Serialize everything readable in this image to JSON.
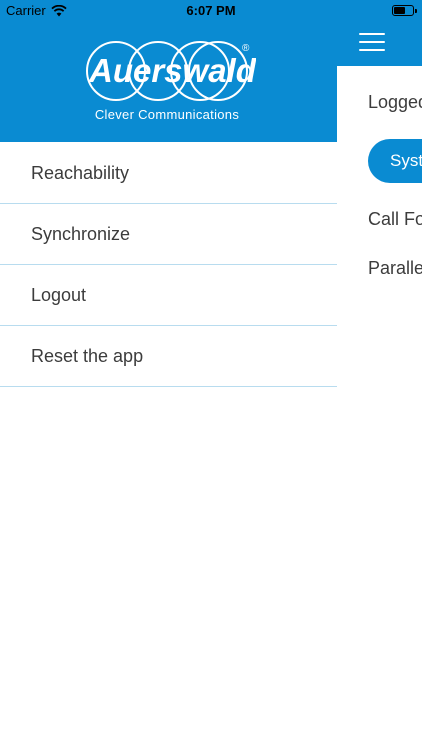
{
  "status_bar": {
    "carrier": "Carrier",
    "time": "6:07 PM",
    "battery_level_fraction": 0.6
  },
  "side_menu": {
    "logo": {
      "brand": "Auerswald",
      "registered_mark": "®",
      "tagline": "Clever Communications"
    },
    "items": [
      {
        "label": "Reachability"
      },
      {
        "label": "Synchronize"
      },
      {
        "label": "Logout"
      },
      {
        "label": "Reset the app"
      }
    ]
  },
  "main": {
    "logged_text": "Logged",
    "system_button_label": "Syst",
    "call_forwarding_text": "Call Fo",
    "parallel_text": "Paralle"
  },
  "colors": {
    "brand_blue": "#0a8bd2",
    "divider": "#b8dcef",
    "text": "#3c3c3c"
  }
}
